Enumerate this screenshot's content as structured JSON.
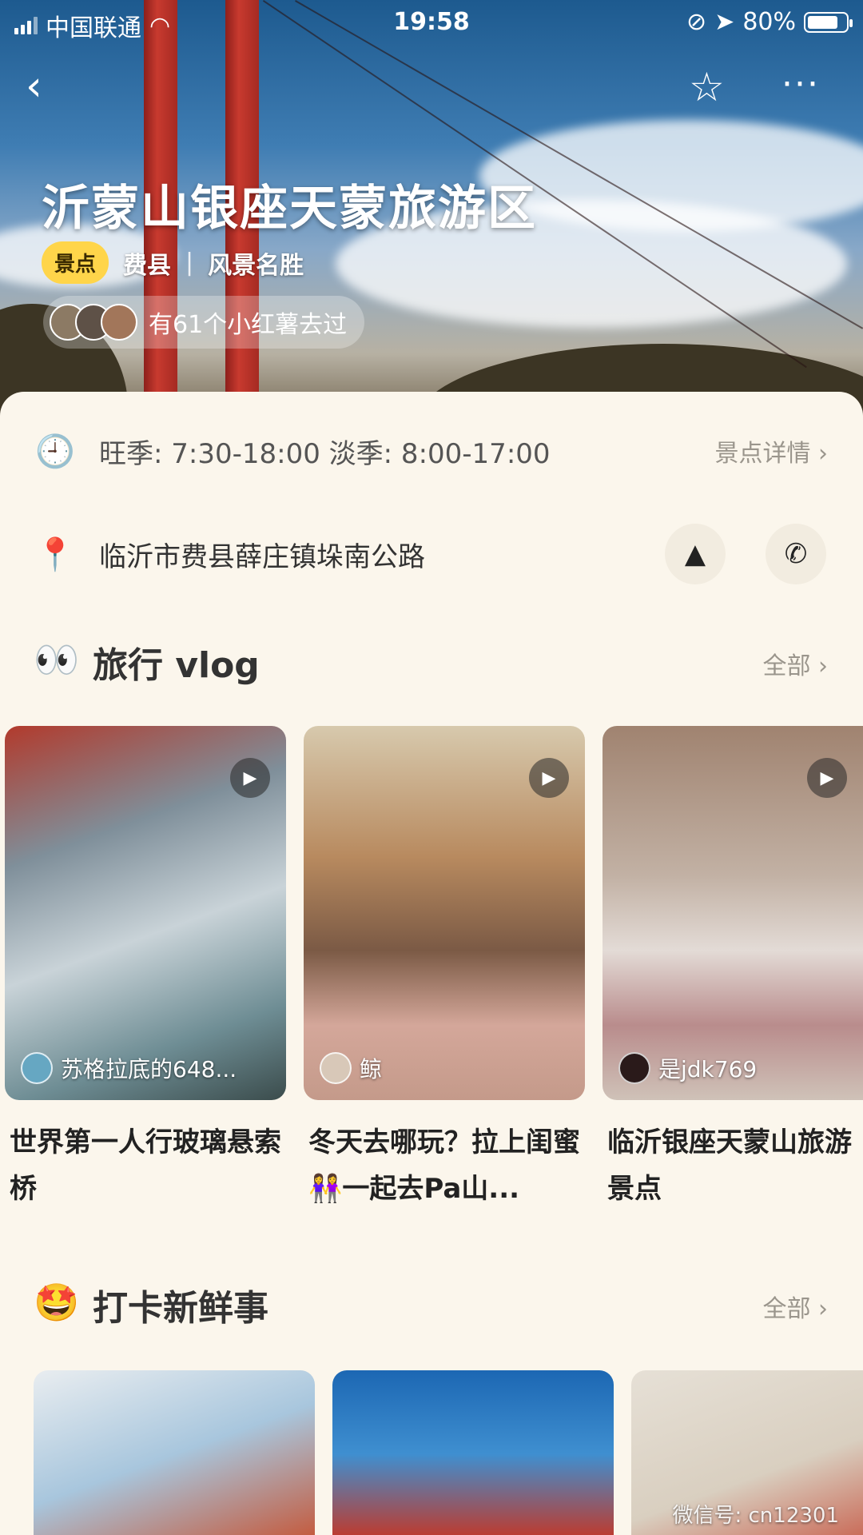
{
  "status_bar": {
    "carrier": "中国联通",
    "time": "19:58",
    "battery": "80%"
  },
  "header": {
    "title": "沂蒙山银座天蒙旅游区",
    "tag": "景点",
    "county": "费县",
    "separator": "|",
    "category": "风景名胜",
    "visited_text": "有61个小红薯去过"
  },
  "info": {
    "hours": "旺季: 7:30-18:00 淡季: 8:00-17:00",
    "detail_link": "景点详情 ›",
    "address": "临沂市费县薛庄镇垛南公路"
  },
  "vlog": {
    "title": "旅行 vlog",
    "more": "全部 ›",
    "items": [
      {
        "author": "苏格拉底的648...",
        "caption": "世界第一人行玻璃悬索桥"
      },
      {
        "author": "鲸",
        "caption": "冬天去哪玩？拉上闺蜜👭一起去Pa山..."
      },
      {
        "author": "是jdk769",
        "caption": "临沂银座天蒙山旅游景点"
      }
    ]
  },
  "checkin": {
    "title": "打卡新鲜事",
    "more": "全部 ›"
  },
  "watermark": "微信号: cn12301"
}
